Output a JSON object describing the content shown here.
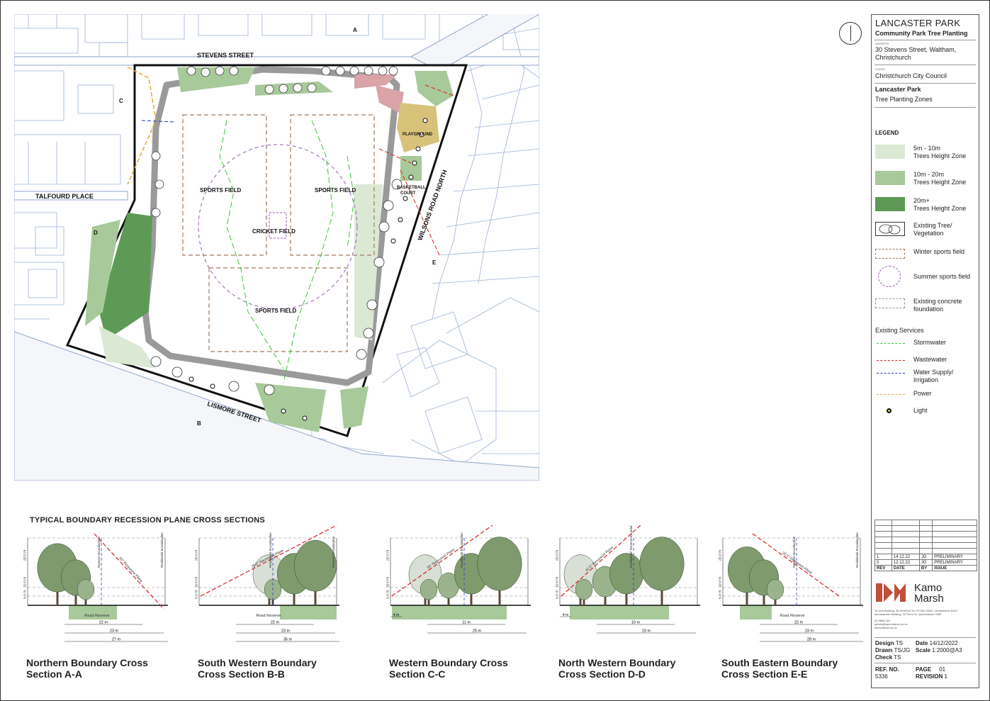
{
  "project": {
    "title": "LANCASTER PARK",
    "subtitle": "Community Park Tree Planting",
    "address_label": "ADDRESS",
    "address_line1": "30 Stevens Street, Waltham,",
    "address_line2": "Christchurch",
    "client_label": "CLIENT",
    "client": "Christchurch City Council",
    "sheet_name": "Lancaster Park",
    "sheet_subtitle": "Tree Planting Zones"
  },
  "map_labels": {
    "stevens_street": "STEVENS STREET",
    "talfourd_place": "TALFOURD PLACE",
    "lismore_street": "LISMORE STREET",
    "wilsons_road": "WILSONS ROAD NORTH",
    "sports_field": "SPORTS FIELD",
    "cricket_field": "CRICKET FIELD",
    "playground": "PLAYGROUND",
    "basketball_1": "BASKETBALL",
    "basketball_2": "COURT",
    "marker_a": "A",
    "marker_b": "B",
    "marker_c": "C",
    "marker_d": "D",
    "marker_e": "E"
  },
  "legend": {
    "title": "LEGEND",
    "items": [
      {
        "label1": "5m - 10m",
        "label2": "Trees Height Zone"
      },
      {
        "label1": "10m - 20m",
        "label2": "Trees Height Zone"
      },
      {
        "label1": "20m+",
        "label2": "Trees Height Zone"
      },
      {
        "label1": "Existing Tree/",
        "label2": "Vegetation"
      },
      {
        "label1": "Winter sports field",
        "label2": ""
      },
      {
        "label1": "Summer sports field",
        "label2": ""
      },
      {
        "label1": "Existing concrete",
        "label2": "foundation"
      }
    ],
    "services_title": "Existing Services",
    "services": [
      {
        "label1": "Stormwater",
        "label2": ""
      },
      {
        "label1": "Wastewater",
        "label2": ""
      },
      {
        "label1": "Water Supply/",
        "label2": "Irrigation"
      },
      {
        "label1": "Power",
        "label2": ""
      },
      {
        "label1": "Light",
        "label2": ""
      }
    ]
  },
  "colors": {
    "zone_5_10": "#dbe8d4",
    "zone_10_20": "#a8c99a",
    "zone_20_plus": "#5d9a55",
    "playground": "#d8c27a",
    "pink_zone": "#d9a3a8",
    "stormwater": "#3cc43c",
    "wastewater": "#e02020",
    "water_supply": "#2233cc",
    "power": "#e6a93a",
    "winter_field": "#a07a5c",
    "summer_field": "#9b59b6",
    "recession_line": "#d62020",
    "boundary_line": "#2a3bd0"
  },
  "revisions": {
    "rows": [
      {
        "rev": "1",
        "date": "14.12.22",
        "by": "JG",
        "issue": "PRELIMINARY"
      },
      {
        "rev": "0",
        "date": "12.12.22",
        "by": "JG",
        "issue": "PRELIMINARY"
      }
    ],
    "header": {
      "rev": "REV",
      "date": "DATE",
      "by": "BY",
      "issue": "ISSUE"
    }
  },
  "company": {
    "name_line1": "Kamo",
    "name_line2": "Marsh",
    "address": "Te Unit Building, 48 Hereford St, PO Box 2853, Christchurch 8140",
    "address2": "Mountaineer Building, 32 Rees St, Queenstown 9300",
    "phone": "03 3668 181",
    "email": "admin@kamomarsh.co.nz",
    "web": "kamomarsh.co.nz"
  },
  "meta": {
    "design_label": "Design",
    "design": "TS",
    "drawn_label": "Drawn",
    "drawn": "TS/JG",
    "check_label": "Check",
    "check": "TS",
    "date_label": "Date",
    "date": "14/12/2022",
    "scale_label": "Scale",
    "scale": "1:2000@A3",
    "ref_label": "REF. NO.",
    "ref": "5336",
    "page_label": "PAGE",
    "page": "01",
    "revision_label": "REVISION",
    "revision": "1"
  },
  "sections": {
    "title": "TYPICAL BOUNDARY RECESSION PLANE CROSS SECTIONS",
    "heights": {
      "h20": "20.0 m",
      "h10": "10.0 m",
      "h5": "5.0 m"
    },
    "items": [
      {
        "caption1": "Northern Boundary Cross",
        "caption2": "Section A-A",
        "plane": "55° Recession Plane",
        "reserve": "Road Reserve",
        "dims": [
          "22 m",
          "23 m",
          "27 m"
        ],
        "left_label": "Reserve Boundaryline",
        "right_label": "Residential Boundaryline",
        "small_dims": []
      },
      {
        "caption1": "South Western Boundary",
        "caption2": "Cross Section B-B",
        "plane": "28.5° Recession Plane",
        "reserve": "Road Reserve",
        "dims": [
          "22 m",
          "23 m",
          "35 m"
        ],
        "left_label": "Residential Boundaryline",
        "right_label": "Reserve Boundaryline",
        "small_dims": []
      },
      {
        "caption1": "Western Boundary Cross",
        "caption2": "Section C-C",
        "plane": "35° Recession Plane",
        "reserve": "",
        "dims": [
          "11 m",
          "25 m"
        ],
        "left_label": "Residential Boundaryline",
        "right_label": "",
        "small_dims": [
          "4 m"
        ]
      },
      {
        "caption1": "North Western Boundary",
        "caption2": "Cross Section D-D",
        "plane": "42.5° Recession Plane",
        "reserve": "",
        "dims": [
          "10 m",
          "23 m"
        ],
        "left_label": "Residential/ Reserve Boundaryline",
        "right_label": "",
        "small_dims": [
          "4 m"
        ]
      },
      {
        "caption1": "South Eastern Boundary",
        "caption2": "Cross Section E-E",
        "plane": "35.5° Recession Plane",
        "reserve": "Road Reserve",
        "dims": [
          "22 m",
          "23 m",
          "28 m"
        ],
        "left_label": "Reserve Boundaryline",
        "right_label": "Residential Boundaryline",
        "small_dims": []
      }
    ]
  }
}
